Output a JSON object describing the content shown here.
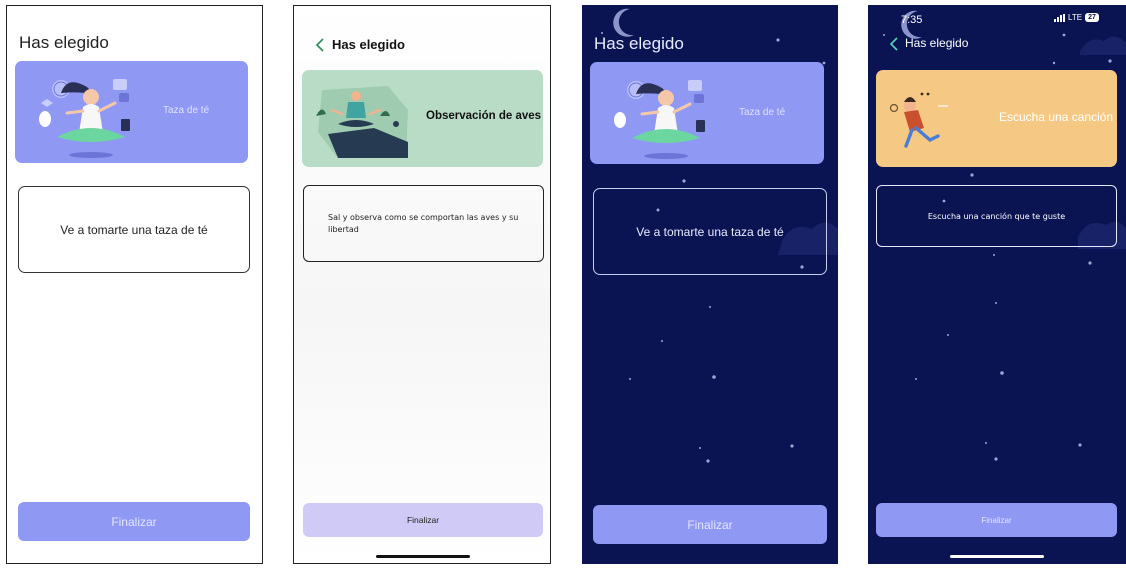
{
  "screens": [
    {
      "title": "Has elegido",
      "activity": "Taza de té",
      "description": "Ve a tomarte una taza de té",
      "button": "Finalizar"
    },
    {
      "title": "Has elegido",
      "activity": "Observación de aves",
      "description": "Sal y observa como se comportan las aves y su libertad",
      "button": "Finalizar"
    },
    {
      "title": "Has elegido",
      "activity": "Taza de té",
      "description": "Ve a tomarte una taza de té",
      "button": "Finalizar"
    },
    {
      "title": "Has elegido",
      "activity": "Escucha una canción",
      "description": "Escucha una canción que te guste",
      "button": "Finalizar",
      "status": {
        "time": "7:35",
        "network": "LTE",
        "battery": "27"
      }
    }
  ],
  "colors": {
    "night_background": "#0b1452",
    "card_purple": "#8f98f3",
    "card_green": "#b9dcc6",
    "card_orange": "#f5c984",
    "button_light_purple": "#cfcbf6"
  },
  "icons": [
    "back-chevron-icon",
    "moon-icon",
    "star-icon",
    "meditation-illustration",
    "birdwatching-illustration",
    "music-illustration",
    "signal-icon",
    "battery-icon"
  ]
}
